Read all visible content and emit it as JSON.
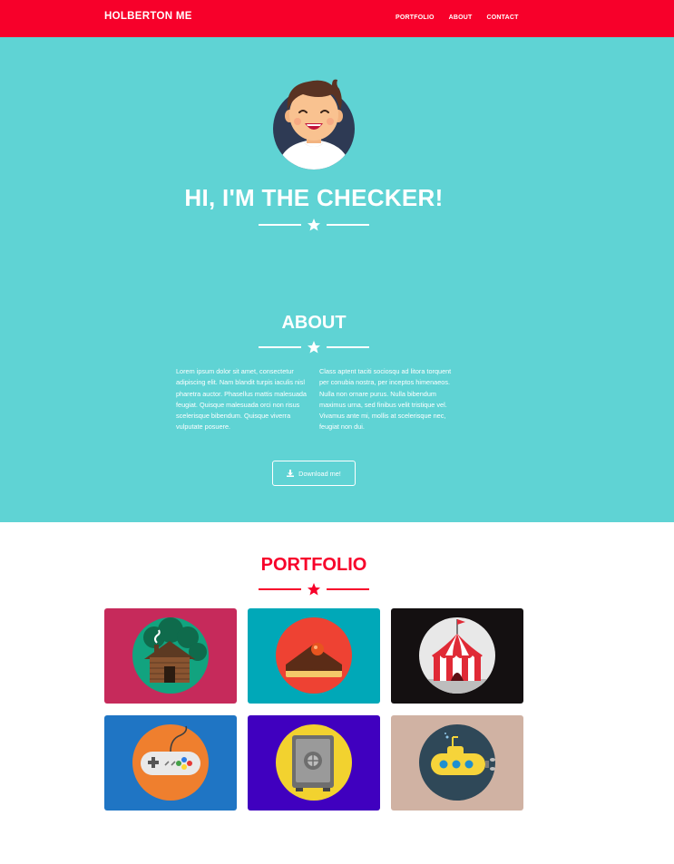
{
  "nav": {
    "brand": "HOLBERTON ME",
    "links": [
      "PORTFOLIO",
      "ABOUT",
      "CONTACT"
    ]
  },
  "hero": {
    "title": "HI, I'M THE CHECKER!",
    "avatar_icon": "avatar-icon",
    "background": "#5fd3d4"
  },
  "about": {
    "title": "ABOUT",
    "col1": "Lorem ipsum dolor sit amet, consectetur adipiscing elit. Nam blandit turpis iaculis nisl pharetra auctor. Phasellus mattis malesuada feugiat. Quisque malesuada orci non risus scelerisque bibendum. Quisque viverra vulputate posuere.",
    "col2": "Class aptent taciti sociosqu ad litora torquent per conubia nostra, per inceptos himenaeos. Nulla non ornare purus. Nulla bibendum maximus urna, sed finibus velit tristique vel. Vivamus ante mi, mollis at scelerisque nec, feugiat non dui.",
    "download_label": "Download me!",
    "download_icon": "download-icon"
  },
  "portfolio": {
    "title": "PORTFOLIO",
    "items": [
      {
        "icon": "cabin-icon",
        "color": "#c62a5b"
      },
      {
        "icon": "cake-icon",
        "color": "#00a8b8"
      },
      {
        "icon": "circus-tent-icon",
        "color": "#141011"
      },
      {
        "icon": "game-controller-icon",
        "color": "#1f75c4"
      },
      {
        "icon": "safe-icon",
        "color": "#4000bf"
      },
      {
        "icon": "submarine-icon",
        "color": "#d0b2a3"
      }
    ]
  },
  "colors": {
    "accent": "#f7002a",
    "hero": "#5fd3d4"
  }
}
